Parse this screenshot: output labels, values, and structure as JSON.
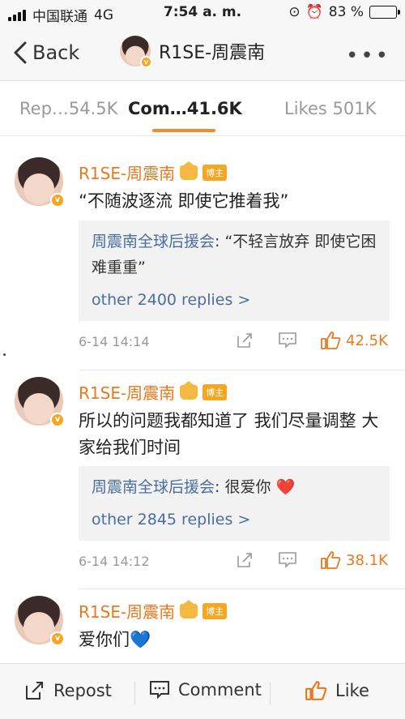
{
  "status_bar": {
    "carrier": "中国联通",
    "network": "4G",
    "time": "7:54 a. m.",
    "battery": "83 %",
    "battery_level": 0.83
  },
  "nav": {
    "back_label": "Back",
    "title": "R1SE-周震南"
  },
  "tabs": [
    {
      "label": "Rep…54.5K"
    },
    {
      "label": "Com…41.6K"
    },
    {
      "label": "Likes 501K"
    }
  ],
  "comments": [
    {
      "author": "R1SE-周震南",
      "badge": "博主",
      "text": "“不随波逐流 即使它推着我”",
      "reply_author": "周震南全球后援会",
      "reply_text": ": “不轻言放弃 即使它困难重重”",
      "reply_more": "other 2400 replies >",
      "date": "6-14 14:14",
      "likes": "42.5K"
    },
    {
      "author": "R1SE-周震南",
      "badge": "博主",
      "text": "所以的问题我都知道了 我们尽量调整 大家给我们时间",
      "reply_author": "周震南全球后援会",
      "reply_text": ": 很爱你 ❤️",
      "reply_more": "other 2845 replies >",
      "date": "6-14 14:12",
      "likes": "38.1K"
    },
    {
      "author": "R1SE-周震南",
      "badge": "博主",
      "text": "爱你们💙"
    }
  ],
  "bottom_bar": {
    "repost": "Repost",
    "comment": "Comment",
    "like": "Like"
  },
  "colors": {
    "accent": "#e8791e",
    "link": "#4a6e9e",
    "tab_underline": "#f58a2a"
  }
}
